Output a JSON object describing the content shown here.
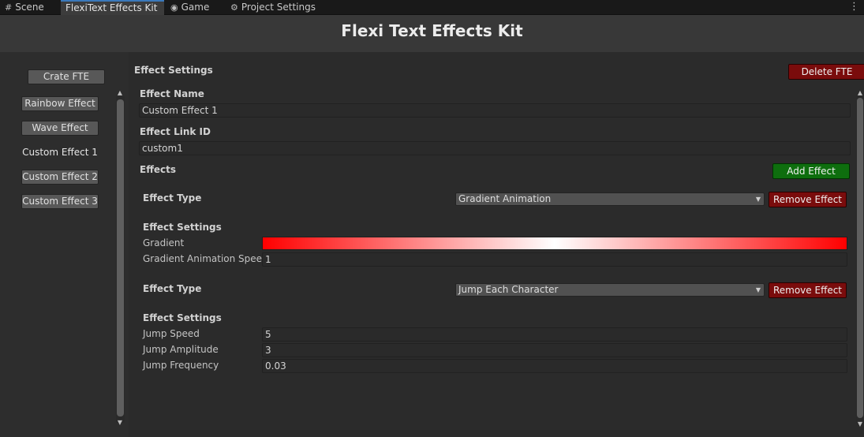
{
  "tabs": [
    {
      "label": "Scene",
      "icon": "grid-icon"
    },
    {
      "label": "FlexiText Effects Kit",
      "icon": ""
    },
    {
      "label": "Game",
      "icon": "gamepad-icon"
    },
    {
      "label": "Project Settings",
      "icon": "gear-icon"
    }
  ],
  "window_title": "Flexi Text Effects Kit",
  "sidebar": {
    "create_button": "Crate FTE",
    "items": [
      "Rainbow Effect",
      "Wave Effect",
      "Custom Effect 1",
      "Custom Effect 2",
      "Custom Effect 3"
    ],
    "selected_index": 2
  },
  "settings": {
    "section_title": "Effect Settings",
    "delete_button": "Delete FTE",
    "effect_name_label": "Effect Name",
    "effect_name_value": "Custom Effect 1",
    "effect_link_label": "Effect Link ID",
    "effect_link_value": "custom1",
    "effects_label": "Effects",
    "add_effect_button": "Add Effect"
  },
  "effects": [
    {
      "type_label": "Effect Type",
      "type_value": "Gradient Animation",
      "remove_label": "Remove Effect",
      "settings_label": "Effect Settings",
      "gradient_label": "Gradient",
      "gradient_colors": [
        "#ff0000",
        "#ffffff",
        "#ff0000"
      ],
      "fields": [
        {
          "label": "Gradient Animation Speed",
          "value": "1"
        }
      ]
    },
    {
      "type_label": "Effect Type",
      "type_value": "Jump Each Character",
      "remove_label": "Remove Effect",
      "settings_label": "Effect Settings",
      "fields": [
        {
          "label": "Jump Speed",
          "value": "5"
        },
        {
          "label": "Jump Amplitude",
          "value": "3"
        },
        {
          "label": "Jump Frequency",
          "value": "0.03"
        }
      ]
    }
  ],
  "colors": {
    "delete": "#7a0c0c",
    "remove": "#7a0c0c",
    "add": "#0e6e0e"
  }
}
